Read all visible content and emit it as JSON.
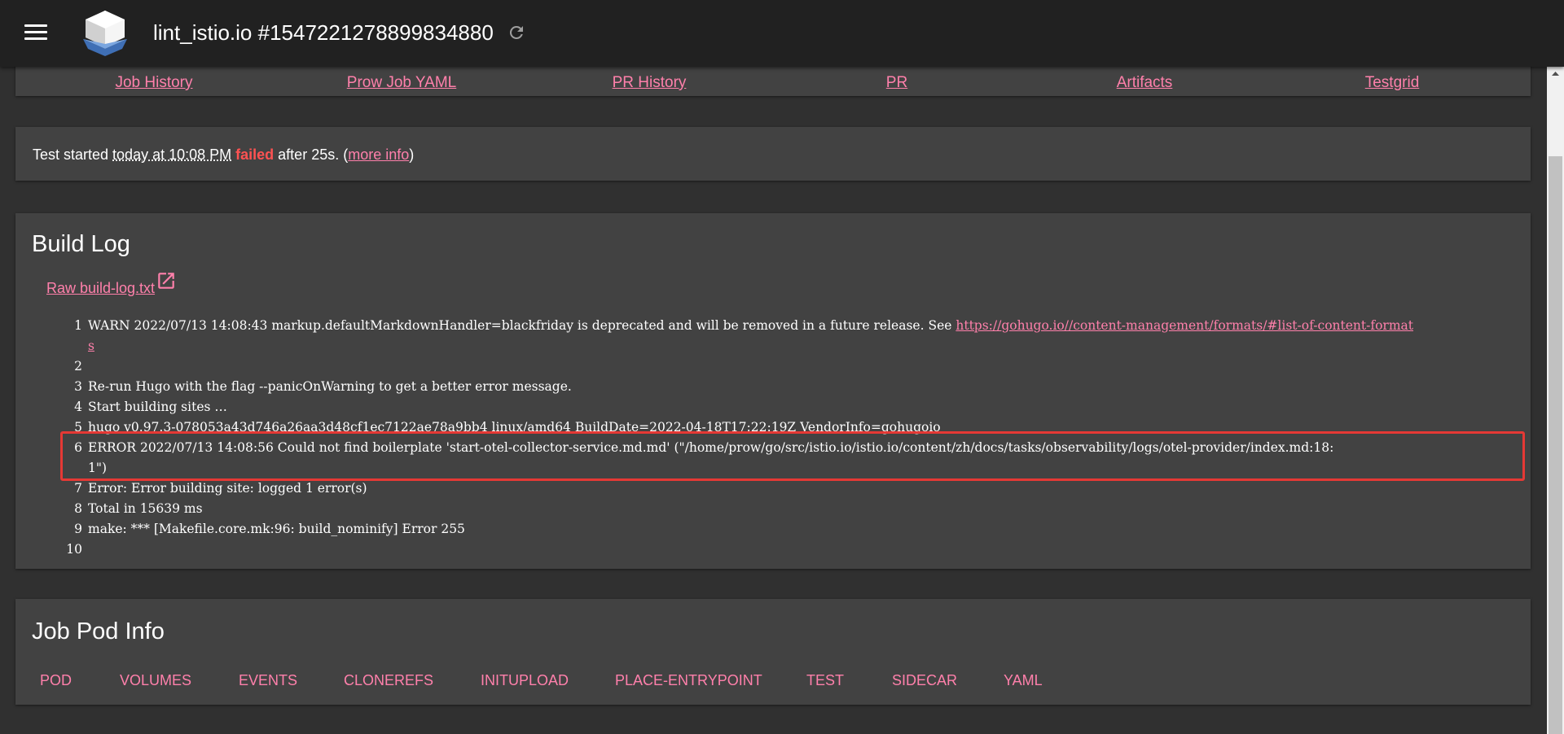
{
  "header": {
    "title": "lint_istio.io #1547221278899834880",
    "menu_icon": "hamburger-menu-icon",
    "logo_icon": "prow-logo-icon",
    "refresh_icon": "refresh-icon"
  },
  "links": [
    {
      "label": "Job History"
    },
    {
      "label": "Prow Job YAML"
    },
    {
      "label": "PR History"
    },
    {
      "label": "PR"
    },
    {
      "label": "Artifacts"
    },
    {
      "label": "Testgrid"
    }
  ],
  "status": {
    "prefix": "Test started ",
    "time": "today at 10:08 PM",
    "result": "failed",
    "middle": " after 25s. (",
    "more_info": "more info",
    "suffix": ")"
  },
  "build_log": {
    "title": "Build Log",
    "raw_link": "Raw build-log.txt",
    "lines": [
      {
        "num": "1",
        "text": "WARN 2022/07/13 14:08:43 markup.defaultMarkdownHandler=blackfriday is deprecated and will be removed in a future release. See ",
        "link": "https://gohugo.io//content-management/formats/#list-of-content-format",
        "cont": "s"
      },
      {
        "num": "2",
        "text": ""
      },
      {
        "num": "3",
        "text": "Re-run Hugo with the flag --panicOnWarning to get a better error message."
      },
      {
        "num": "4",
        "text": "Start building sites …"
      },
      {
        "num": "5",
        "text": "hugo v0.97.3-078053a43d746a26aa3d48cf1ec7122ae78a9bb4 linux/amd64 BuildDate=2022-04-18T17:22:19Z VendorInfo=gohugoio"
      },
      {
        "num": "6",
        "text": "ERROR 2022/07/13 14:08:56 Could not find boilerplate 'start-otel-collector-service.md.md' (\"/home/prow/go/src/istio.io/istio.io/content/zh/docs/tasks/observability/logs/otel-provider/index.md:18:",
        "cont": "1\")"
      },
      {
        "num": "7",
        "text": "Error: Error building site: logged 1 error(s)"
      },
      {
        "num": "8",
        "text": "Total in 15639 ms"
      },
      {
        "num": "9",
        "text": "make: *** [Makefile.core.mk:96: build_nominify] Error 255"
      },
      {
        "num": "10",
        "text": ""
      }
    ]
  },
  "job_pod_info": {
    "title": "Job Pod Info",
    "tabs": [
      "POD",
      "VOLUMES",
      "EVENTS",
      "CLONEREFS",
      "INITUPLOAD",
      "PLACE-ENTRYPOINT",
      "TEST",
      "SIDECAR",
      "YAML"
    ]
  },
  "colors": {
    "link": "#ff80ab",
    "failed": "#ff5252",
    "highlight_border": "#e53935"
  }
}
